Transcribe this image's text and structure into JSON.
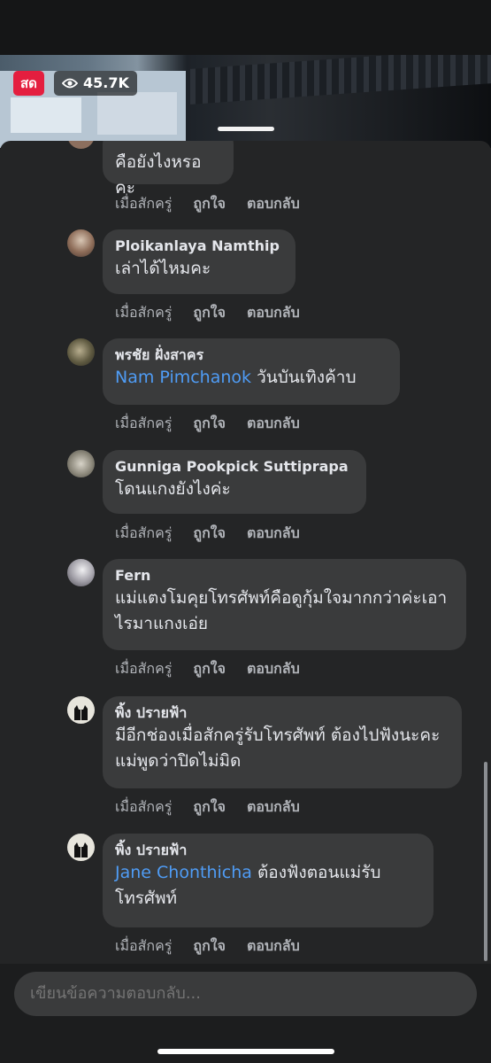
{
  "live": {
    "badge": "สด",
    "viewers": "45.7K"
  },
  "comments": [
    {
      "name": "",
      "text": "คือยังไงหรอ คะ",
      "mention": "",
      "time": "เมื่อสักครู่",
      "like": "ถูกใจ",
      "reply": "ตอบกลับ"
    },
    {
      "name": "Ploikanlaya Namthip",
      "text": "เล่าได้ไหมคะ",
      "mention": "",
      "time": "เมื่อสักครู่",
      "like": "ถูกใจ",
      "reply": "ตอบกลับ"
    },
    {
      "name": "พรชัย ฝั่งสาคร",
      "mention": "Nam Pimchanok",
      "text": " วันบันเทิงค้าบ",
      "time": "เมื่อสักครู่",
      "like": "ถูกใจ",
      "reply": "ตอบกลับ"
    },
    {
      "name": "Gunniga Pookpick Suttiprapa",
      "text": "โดนแกงยังไงค่ะ",
      "mention": "",
      "time": "เมื่อสักครู่",
      "like": "ถูกใจ",
      "reply": "ตอบกลับ"
    },
    {
      "name": "Fern",
      "text": "แม่แตงโมคุยโทรศัพท์คือดูกุ้มใจมากกว่าค่ะเอาไรมาแกงเอ่ย",
      "mention": "",
      "time": "เมื่อสักครู่",
      "like": "ถูกใจ",
      "reply": "ตอบกลับ"
    },
    {
      "name": "พิ้ง ปรายฟ้า",
      "text": "มีอีกช่องเมื่อสักครู่รับโทรศัพท์ ต้องไปฟังนะคะ แม่พูดว่าปิดไม่มิด",
      "mention": "",
      "time": "เมื่อสักครู่",
      "like": "ถูกใจ",
      "reply": "ตอบกลับ"
    },
    {
      "name": "พิ้ง ปรายฟ้า",
      "mention": "Jane Chonthicha",
      "text": " ต้องฟังตอนแม่รับโทรศัพท์",
      "time": "เมื่อสักครู่",
      "like": "ถูกใจ",
      "reply": "ตอบกลับ"
    }
  ],
  "composer": {
    "placeholder": "เขียนข้อความตอบกลับ..."
  },
  "colors": {
    "background": "#242526",
    "bubble": "#3a3b3c",
    "mention": "#4f9cf5",
    "live": "#e41e3f"
  }
}
